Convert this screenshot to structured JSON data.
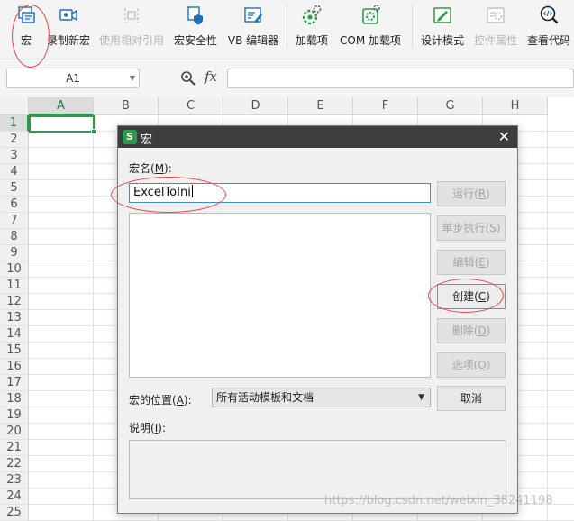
{
  "ribbon": {
    "items": [
      {
        "label": "宏",
        "icon": "macro-icon",
        "disabled": false
      },
      {
        "label": "录制新宏",
        "icon": "record-macro-icon",
        "disabled": false
      },
      {
        "label": "使用相对引用",
        "icon": "relative-reference-icon",
        "disabled": true
      },
      {
        "label": "宏安全性",
        "icon": "macro-security-icon",
        "disabled": false
      },
      {
        "label": "VB 编辑器",
        "icon": "vb-editor-icon",
        "disabled": false
      },
      {
        "label": "加载项",
        "icon": "addins-icon",
        "disabled": false
      },
      {
        "label": "COM 加载项",
        "icon": "com-addins-icon",
        "disabled": false
      },
      {
        "label": "设计模式",
        "icon": "design-mode-icon",
        "disabled": false
      },
      {
        "label": "控件属性",
        "icon": "control-properties-icon",
        "disabled": true
      },
      {
        "label": "查看代码",
        "icon": "view-code-icon",
        "disabled": false
      }
    ]
  },
  "formula_bar": {
    "cell_ref": "A1",
    "fx": "fx",
    "value": ""
  },
  "sheet": {
    "columns": [
      "A",
      "B",
      "C",
      "D",
      "E",
      "F",
      "G",
      "H"
    ],
    "rows": [
      "1",
      "2",
      "3",
      "4",
      "5",
      "6",
      "7",
      "8",
      "9",
      "10",
      "11",
      "12",
      "13",
      "14",
      "15",
      "16",
      "17",
      "18",
      "19",
      "20",
      "21",
      "22",
      "23",
      "24",
      "25"
    ],
    "selected_cell": "A1"
  },
  "dialog": {
    "logo": "S",
    "title": "宏",
    "close": "✕",
    "name_label_pre": "宏名(",
    "name_label_key": "M",
    "name_label_post": "):",
    "name_value": "ExcelToIni",
    "buttons": {
      "run": {
        "pre": "运行(",
        "key": "R",
        "post": ")",
        "disabled": true
      },
      "step": {
        "pre": "单步执行(",
        "key": "S",
        "post": ")",
        "disabled": true
      },
      "edit": {
        "pre": "编辑(",
        "key": "E",
        "post": ")",
        "disabled": true
      },
      "create": {
        "pre": "创建(",
        "key": "C",
        "post": ")",
        "disabled": false
      },
      "delete": {
        "pre": "删除(",
        "key": "D",
        "post": ")",
        "disabled": true
      },
      "options": {
        "pre": "选项(",
        "key": "O",
        "post": ")",
        "disabled": true
      },
      "cancel": {
        "label": "取消",
        "disabled": false
      }
    },
    "location_label_pre": "宏的位置(",
    "location_label_key": "A",
    "location_label_post": "):",
    "location_value": "所有活动模板和文档",
    "desc_label_pre": "说明(",
    "desc_label_key": "I",
    "desc_label_post": "):"
  },
  "watermark": "https://blog.csdn.net/weixin_38241198",
  "colors": {
    "accent_green": "#2e9a4b",
    "annotation_red": "#e0474c",
    "titlebar": "#3d3d3d"
  }
}
